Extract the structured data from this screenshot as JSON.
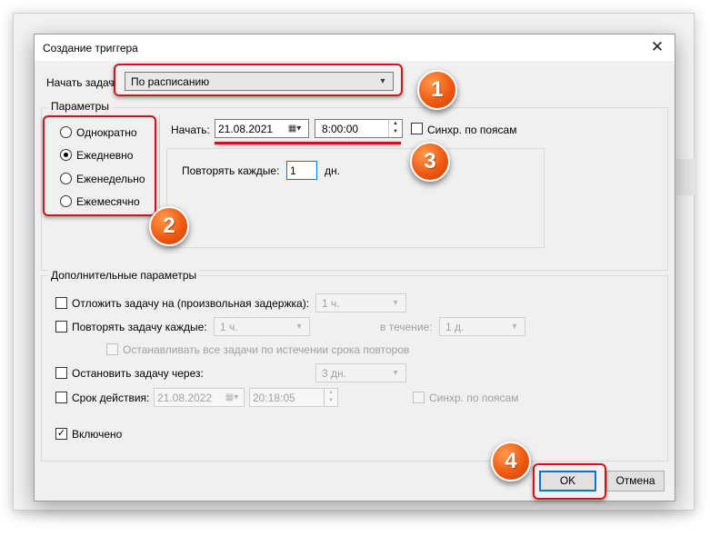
{
  "dialog": {
    "title": "Создание триггера"
  },
  "begin": {
    "label": "Начать задач",
    "value": "По расписанию"
  },
  "params": {
    "title": "Параметры",
    "options": [
      "Однократно",
      "Ежедневно",
      "Еженедельно",
      "Ежемесячно"
    ],
    "selected": "Ежедневно",
    "start_label": "Начать:",
    "start_date": "21.08.2021",
    "start_time": "8:00:00",
    "sync_label": "Синхр. по поясам",
    "repeat_label": "Повторять каждые:",
    "repeat_value": "1",
    "repeat_unit": "дн."
  },
  "advanced": {
    "title": "Дополнительные параметры",
    "delay_label": "Отложить задачу на (произвольная задержка):",
    "delay_value": "1 ч.",
    "repeat_label": "Повторять задачу каждые:",
    "repeat_value": "1 ч.",
    "during_label": "в течение:",
    "during_value": "1 д.",
    "stop_all_label": "Останавливать все задачи по истечении срока повторов",
    "stop_after_label": "Остановить задачу через:",
    "stop_after_value": "3 дн.",
    "expire_label": "Срок действия:",
    "expire_date": "21.08.2022",
    "expire_time": "20:18:05",
    "expire_sync_label": "Синхр. по поясам",
    "enabled_label": "Включено",
    "enabled_checked": true
  },
  "buttons": {
    "ok": "OK",
    "cancel": "Отмена"
  },
  "badges": [
    "1",
    "2",
    "3",
    "4"
  ],
  "colors": {
    "highlight": "#d0141a",
    "badge": "#ef5a12",
    "default_button_border": "#0078d7"
  }
}
